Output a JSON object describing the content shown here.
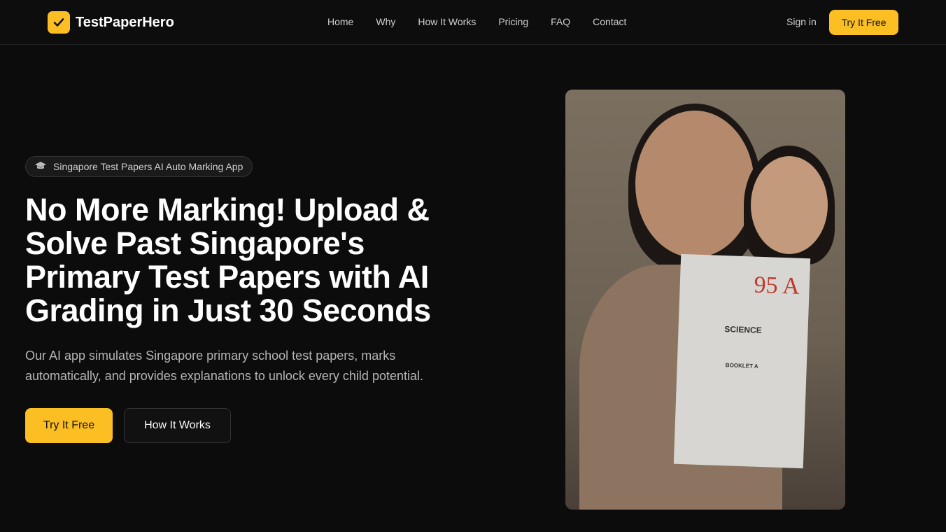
{
  "nav": {
    "brand": "TestPaperHero",
    "links": [
      "Home",
      "Why",
      "How It Works",
      "Pricing",
      "FAQ",
      "Contact"
    ],
    "signin": "Sign in",
    "cta": "Try It Free"
  },
  "hero": {
    "badge": "Singapore Test Papers AI Auto Marking App",
    "title": "No More Marking! Upload & Solve Past Singapore's Primary Test Papers with AI Grading in Just 30 Seconds",
    "subtitle": "Our AI app simulates Singapore primary school test papers, marks automatically, and provides explanations to unlock every child potential.",
    "primary": "Try It Free",
    "secondary": "How It Works"
  },
  "photo": {
    "grade": "95 A",
    "subject": "SCIENCE",
    "booklet": "BOOKLET A"
  },
  "colors": {
    "accent": "#fbbf24",
    "background": "#0c0c0c"
  }
}
